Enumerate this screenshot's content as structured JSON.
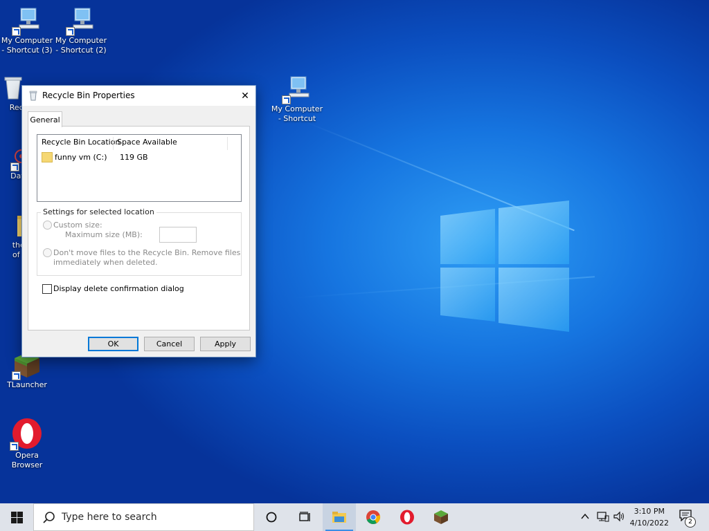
{
  "desktop": {
    "icons": [
      {
        "line1": "My Computer",
        "line2": "- Shortcut (3)"
      },
      {
        "line1": "My Computer",
        "line2": "- Shortcut (2)"
      },
      {
        "line1": "My Computer",
        "line2": "- Shortcut"
      },
      {
        "line1": "Recy",
        "line2": ""
      },
      {
        "line1": "DataV",
        "line2": ""
      },
      {
        "line1": "the n",
        "line2": "of pu"
      },
      {
        "line1": "TLauncher",
        "line2": ""
      },
      {
        "line1": "Opera",
        "line2": "Browser"
      }
    ]
  },
  "dialog": {
    "title": "Recycle Bin Properties",
    "close_glyph": "✕",
    "tab_general": "General",
    "list": {
      "col_location": "Recycle Bin Location",
      "col_space": "Space Available",
      "rows": [
        {
          "location": "funny vm (C:)",
          "space": "119 GB"
        }
      ]
    },
    "settings": {
      "group_label": "Settings for selected location",
      "custom_size": "Custom size:",
      "max_size_label": "Maximum size (MB):",
      "max_size_value": "",
      "dont_move_line1": "Don't move files to the Recycle Bin. Remove files",
      "dont_move_line2": "immediately when deleted."
    },
    "confirm_dialog": {
      "label": "Display delete confirmation dialog",
      "checked": false
    },
    "buttons": {
      "ok": "OK",
      "cancel": "Cancel",
      "apply": "Apply"
    }
  },
  "taskbar": {
    "search_placeholder": "Type here to search",
    "time": "3:10 PM",
    "date": "4/10/2022",
    "notification_count": "2"
  },
  "colors": {
    "accent": "#0078d7",
    "desktop_blue": "#1675e0",
    "taskbar": "#dfe3ea"
  }
}
